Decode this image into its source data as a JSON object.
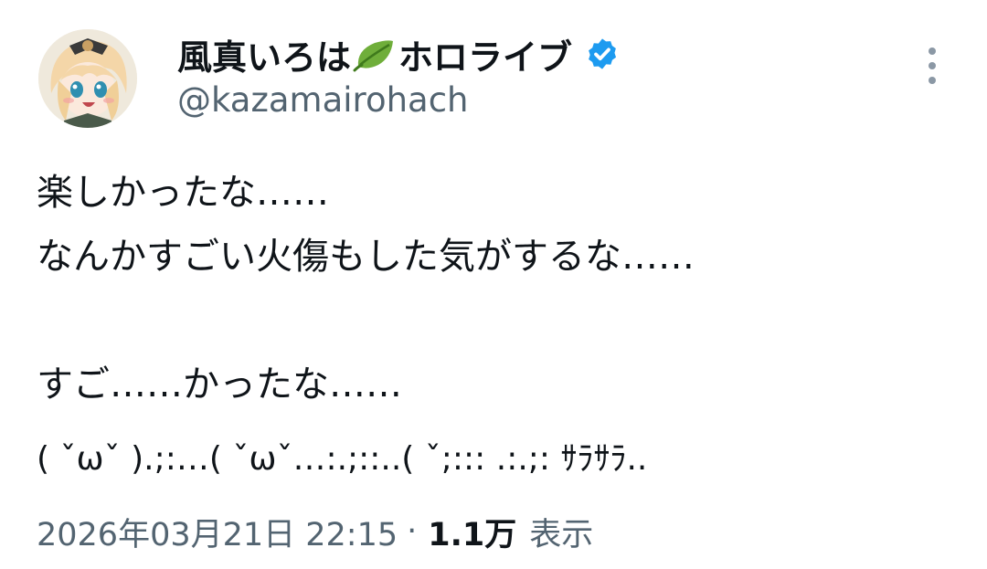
{
  "author": {
    "display_name": "風真いろは",
    "display_name_suffix": "ホロライブ",
    "handle": "@kazamairohach",
    "verified_color": "#1d9bf0",
    "leaf_icon": "leaf-icon",
    "verified_icon": "verified-badge-icon"
  },
  "menu": {
    "icon": "more-vertical-icon"
  },
  "tweet": {
    "lines": [
      "楽しかったな……",
      "なんかすごい火傷もした気がするな……",
      "",
      "すご……かったな……",
      "( ˇωˇ ).;:…( ˇωˇ…:.;::..( ˇ;::: .:.;: ｻﾗｻﾗ.."
    ]
  },
  "meta": {
    "timestamp": "2026年03月21日 22:15",
    "separator": "·",
    "views_count": "1.1万",
    "views_label": "表示"
  },
  "colors": {
    "text_primary": "#0f1419",
    "text_secondary": "#536471",
    "accent": "#1d9bf0",
    "leaf": "#6fae3a"
  }
}
